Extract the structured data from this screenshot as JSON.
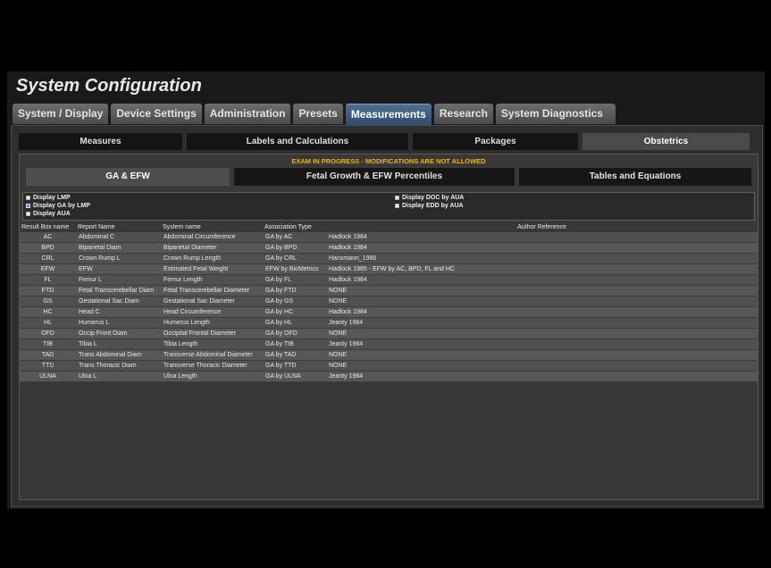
{
  "window": {
    "title": "System Configuration"
  },
  "main_tabs": [
    {
      "label": "System / Display"
    },
    {
      "label": "Device Settings"
    },
    {
      "label": "Administration"
    },
    {
      "label": "Presets"
    },
    {
      "label": "Measurements"
    },
    {
      "label": "Research"
    },
    {
      "label": "System Diagnostics"
    }
  ],
  "sub_tabs": [
    {
      "label": "Measures"
    },
    {
      "label": "Labels and Calculations"
    },
    {
      "label": "Packages"
    },
    {
      "label": "Obstetrics"
    }
  ],
  "warning": "EXAM IN PROGRESS - MODIFICATIONS ARE NOT ALLOWED",
  "inner_tabs": [
    {
      "label": "GA & EFW"
    },
    {
      "label": "Fetal Growth & EFW Percentiles"
    },
    {
      "label": "Tables and Equations"
    }
  ],
  "options": {
    "display_lmp": "Display LMP",
    "display_ga_by_lmp": "Display GA by LMP",
    "display_aua": "Display AUA",
    "display_doc_by_aua": "Display DOC by AUA",
    "display_edd_by_aua": "Display EDD by AUA"
  },
  "table": {
    "headers": [
      "Result Box name",
      "Report Name",
      "System name",
      "Association Type",
      "Author Reference"
    ],
    "rows": [
      [
        "AC",
        "Abdominal C",
        "Abdominal Circumference",
        "GA by AC",
        "Hadlock 1984"
      ],
      [
        "BPD",
        "Biparietal Diam",
        "Biparietal Diameter",
        "GA by BPD",
        "Hadlock 1984"
      ],
      [
        "CRL",
        "Crown Rump L",
        "Crown Rump Length",
        "GA by CRL",
        "Hansmann_1986"
      ],
      [
        "EFW",
        "EFW",
        "Estimated Fetal Weight",
        "EFW by BioMetrics",
        "Hadlock 1985 - EFW by AC, BPD, FL and HC"
      ],
      [
        "FL",
        "Femur L",
        "Femur Length",
        "GA by FL",
        "Hadlock 1984"
      ],
      [
        "FTD",
        "Fetal Transcerebellar Diam",
        "Fetal Transcerebellar Diameter",
        "GA by FTD",
        "NONE"
      ],
      [
        "GS",
        "Gestational Sac Diam",
        "Gestational Sac Diameter",
        "GA by GS",
        "NONE"
      ],
      [
        "HC",
        "Head C",
        "Head Circumference",
        "GA by HC",
        "Hadlock 1984"
      ],
      [
        "HL",
        "Humerus L",
        "Humerus Length",
        "GA by HL",
        "Jeanty 1984"
      ],
      [
        "OFD",
        "Occip Front Diam",
        "Occipital Frontal Diameter",
        "GA by OFD",
        "NONE"
      ],
      [
        "TIB",
        "Tibia L",
        "Tibia Length",
        "GA by TIB",
        "Jeanty 1984"
      ],
      [
        "TAD",
        "Trans Abdominal Diam",
        "Transverse Abdominal Diameter",
        "GA by TAD",
        "NONE"
      ],
      [
        "TTD",
        "Trans Thoracic Diam",
        "Transverse Thoracic Diameter",
        "GA by TTD",
        "NONE"
      ],
      [
        "ULNA",
        "Ulna L",
        "Ulna Length",
        "GA by ULNA",
        "Jeanty 1984"
      ]
    ]
  }
}
